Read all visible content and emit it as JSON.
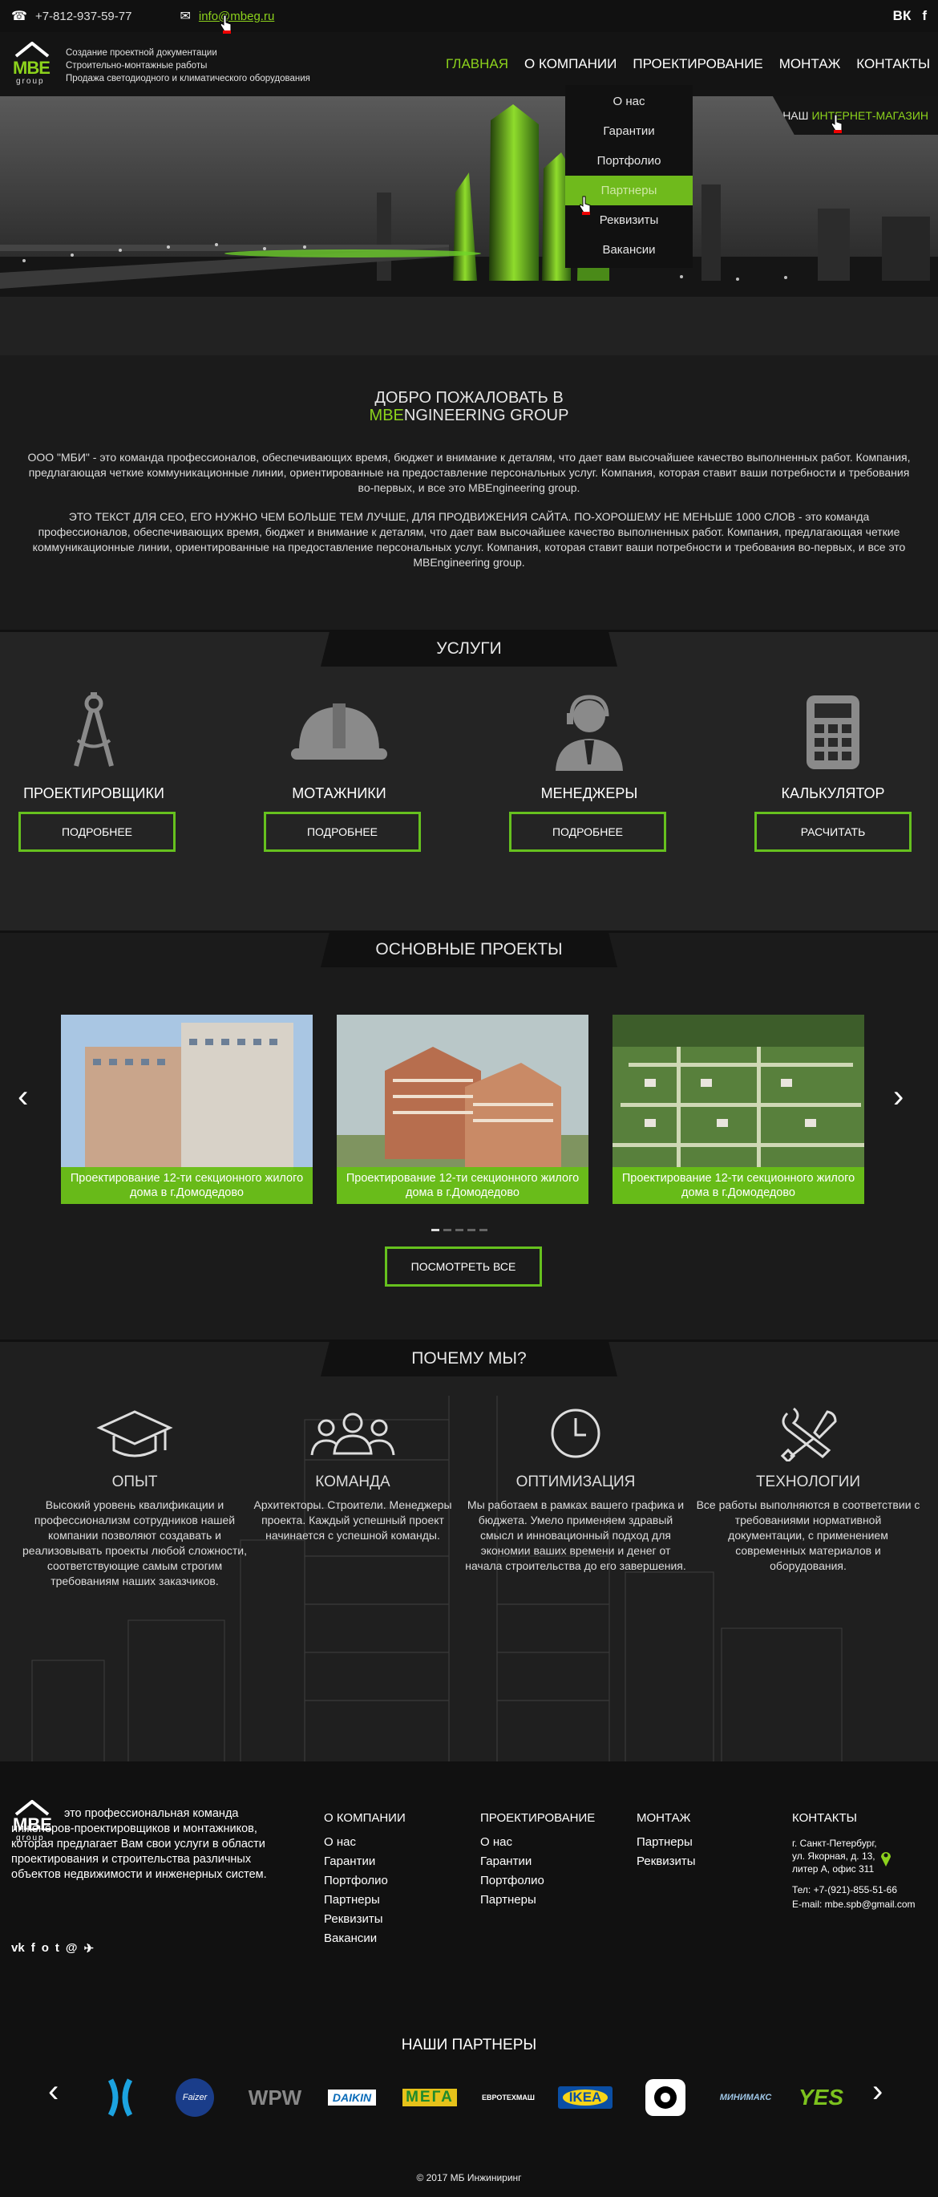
{
  "topbar": {
    "phone": "+7-812-937-59-77",
    "email": "info@mbeg.ru",
    "social": [
      "ВК",
      "f"
    ]
  },
  "header": {
    "logo_main": "MBE",
    "logo_sub": "group",
    "tagline": [
      "Создание проектной документации",
      "Строительно-монтажные работы",
      "Продажа светодиодного и климатического оборудования"
    ],
    "nav": [
      "ГЛАВНАЯ",
      "О КОМПАНИИ",
      "ПРОЕКТИРОВАНИЕ",
      "МОНТАЖ",
      "КОНТАКТЫ"
    ],
    "shop_prefix": "НАШ",
    "shop_link": "ИНТЕРНЕТ-МАГАЗИН"
  },
  "dropdown": [
    "О нас",
    "Гарантии",
    "Портфолио",
    "Партнеры",
    "Реквизиты",
    "Вакансии"
  ],
  "welcome": {
    "line1": "ДОБРО ПОЖАЛОВАТЬ В",
    "brand_green": "MBE",
    "brand_rest": "NGINEERING GROUP",
    "p1": "ООО \"МБИ\" - это команда профессионалов, обеспечивающих время, бюджет и внимание к деталям, что дает вам высочайшее качество выполненных работ. Компания, предлагающая четкие коммуникационные линии, ориентированные на предоставление персональных услуг. Компания, которая ставит ваши потребности и требования во-первых, и все это MBEngineering group.",
    "p2": "ЭТО ТЕКСТ ДЛЯ СЕО, ЕГО НУЖНО ЧЕМ БОЛЬШЕ ТЕМ ЛУЧШЕ, ДЛЯ ПРОДВИЖЕНИЯ САЙТА. ПО-ХОРОШЕМУ НЕ МЕНЬШЕ  1000 СЛОВ - это команда профессионалов, обеспечивающих время, бюджет и внимание к деталям, что дает вам высочайшее качество выполненных работ. Компания, предлагающая четкие коммуникационные линии, ориентированные на предоставление персональных услуг. Компания, которая ставит ваши потребности и требования во-первых, и все это MBEngineering group."
  },
  "services": {
    "title": "УСЛУГИ",
    "items": [
      {
        "name": "ПРОЕКТИРОВЩИКИ",
        "button": "ПОДРОБНЕЕ",
        "icon": "compass-icon"
      },
      {
        "name": "МОТАЖНИКИ",
        "button": "ПОДРОБНЕЕ",
        "icon": "helmet-icon"
      },
      {
        "name": "МЕНЕДЖЕРЫ",
        "button": "ПОДРОБНЕЕ",
        "icon": "manager-icon"
      },
      {
        "name": "КАЛЬКУЛЯТОР",
        "button": "РАСЧИТАТЬ",
        "icon": "calculator-icon"
      }
    ]
  },
  "projects": {
    "title": "ОСНОВНЫЕ ПРОЕКТЫ",
    "items": [
      {
        "caption": "Проектирование 12-ти секционного жилого дома в г.Домодедово"
      },
      {
        "caption": "Проектирование 12-ти секционного жилого дома в г.Домодедово"
      },
      {
        "caption": "Проектирование 12-ти секционного жилого дома в г.Домодедово"
      }
    ],
    "button": "ПОСМОТРЕТЬ ВСЕ"
  },
  "why": {
    "title": "ПОЧЕМУ МЫ?",
    "items": [
      {
        "name": "ОПЫТ",
        "text": "Высокий уровень квалификации и профессионализм сотрудников нашей компании позволяют создавать и реализовывать проекты любой сложности, соответствующие самым строгим требованиям наших заказчиков.",
        "icon": "graduation-cap-icon"
      },
      {
        "name": "КОМАНДА",
        "text": "Архитекторы. Строители. Менеджеры проекта. Каждый успешный проект начинается с успешной команды.",
        "icon": "team-icon"
      },
      {
        "name": "ОПТИМИЗАЦИЯ",
        "text": "Мы работаем в рамках вашего графика и бюджета. Умело применяем здравый смысл и инновационный подход для экономии ваших времени и денег от начала строительства до его завершения.",
        "icon": "clock-icon"
      },
      {
        "name": "ТЕХНОЛОГИИ",
        "text": "Все работы выполняются в соответствии с требованиями нормативной документации, с применением современных материалов и оборудования.",
        "icon": "tools-icon"
      }
    ]
  },
  "footer": {
    "about": "это профессиональная команда инженеров-проектировщиков и монтажников, которая предлагает Вам свои услуги в области проектирования и строительства различных объектов недвижимости и инженерных систем.",
    "cols": [
      {
        "title": "О КОМПАНИИ",
        "links": [
          "О нас",
          "Гарантии",
          "Портфолио",
          "Партнеры",
          "Реквизиты",
          "Вакансии"
        ]
      },
      {
        "title": "ПРОЕКТИРОВАНИЕ",
        "links": [
          "О нас",
          "Гарантии",
          "Портфолио",
          "Партнеры"
        ]
      },
      {
        "title": "МОНТАЖ",
        "links": [
          "Партнеры",
          "Реквизиты"
        ]
      }
    ],
    "contacts_title": "КОНТАКТЫ",
    "address": [
      "г. Санкт-Петербург,",
      "ул. Якорная, д. 13,",
      "литер А, офис 311"
    ],
    "phone": "Тел: +7-(921)-855-51-66",
    "email": "E-mail: mbe.spb@gmail.com",
    "partners_title": "НАШИ ПАРТНЕРЫ",
    "partners": [
      "Faizer",
      "WPW",
      "DAIKIN",
      "МЕГА",
      "ЕВРОТЕХМАШ",
      "IKEA",
      "МИНИМАКС",
      "YES"
    ],
    "copyright": "© 2017 МБ Инжиниринг"
  },
  "colors": {
    "accent": "#8cd21c",
    "button_border": "#66c11e",
    "caption_bg": "#68be16"
  }
}
